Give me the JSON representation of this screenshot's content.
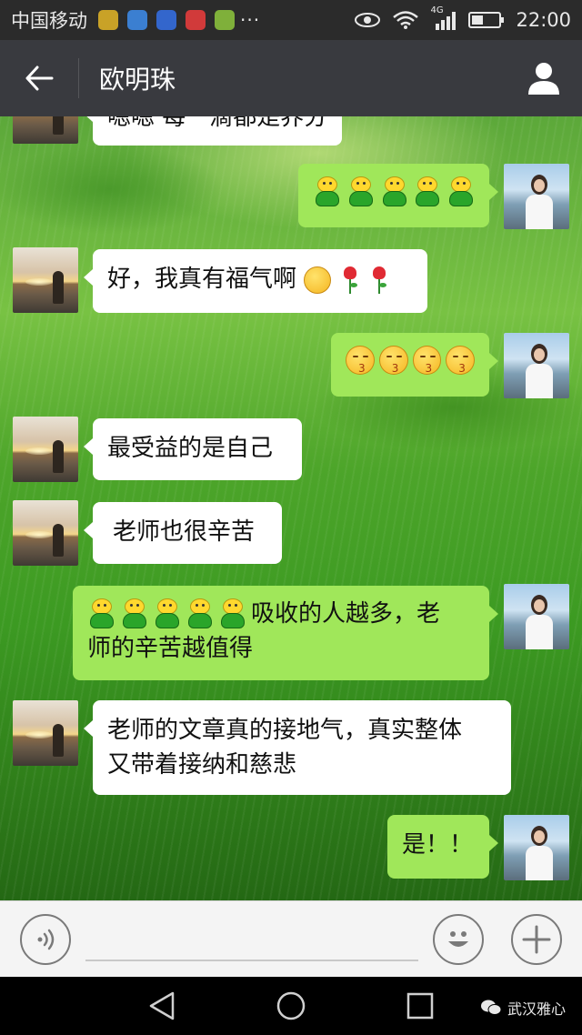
{
  "status_bar": {
    "carrier": "中国移动",
    "more": "···",
    "network": "4G",
    "time": "22:00",
    "notification_icon_colors": [
      "#c9a227",
      "#3b7fd1",
      "#3366cc",
      "#d13a3a",
      "#7fb03a"
    ]
  },
  "header": {
    "title": "欧明珠"
  },
  "messages": [
    {
      "side": "left",
      "text": "嗯嗯 每一滴都是养分"
    },
    {
      "side": "right",
      "emoji": [
        "frog",
        "frog",
        "frog",
        "frog",
        "frog"
      ]
    },
    {
      "side": "left",
      "text": "好，我真有福气啊",
      "emoji_after": [
        "thinking",
        "rose",
        "rose"
      ]
    },
    {
      "side": "right",
      "emoji": [
        "kiss",
        "kiss",
        "kiss",
        "kiss"
      ]
    },
    {
      "side": "left",
      "text": "最受益的是自己"
    },
    {
      "side": "left",
      "text": "老师也很辛苦"
    },
    {
      "side": "right",
      "emoji": [
        "frog",
        "frog",
        "frog",
        "frog",
        "frog"
      ],
      "text_line1": "吸收的人越多，老",
      "text_line2": "师的辛苦越值得"
    },
    {
      "side": "left",
      "text_line1": "老师的文章真的接地气，真实整体",
      "text_line2": "又带着接纳和慈悲"
    },
    {
      "side": "right",
      "text": "是！！"
    }
  ],
  "input_bar": {
    "placeholder": ""
  },
  "watermark": {
    "text": "武汉雅心"
  },
  "colors": {
    "header_bg": "#393a3f",
    "status_bg": "#2b2b2b",
    "bubble_sent": "#a0e75a",
    "bubble_received": "#ffffff"
  }
}
